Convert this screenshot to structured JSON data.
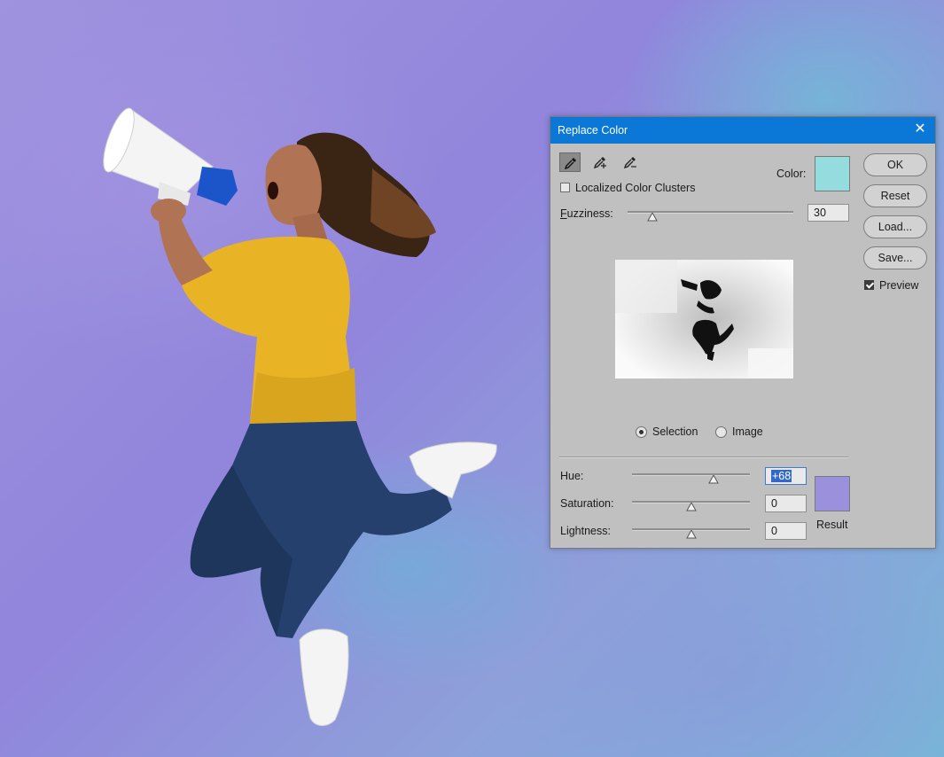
{
  "dialog": {
    "title": "Replace Color",
    "tools": [
      "eyedropper-icon",
      "eyedropper-plus-icon",
      "eyedropper-minus-icon"
    ],
    "localized_label": "Localized Color Clusters",
    "localized_checked": false,
    "color_label": "Color:",
    "color_hex": "#95dcde",
    "fuzziness_label": "Fuzziness:",
    "fuzziness_value": "30",
    "fuzziness_max": 200,
    "view_selection_label": "Selection",
    "view_image_label": "Image",
    "view_selected": "Selection",
    "hue_label": "Hue:",
    "hue_value": "+68",
    "saturation_label": "Saturation:",
    "saturation_value": "0",
    "lightness_label": "Lightness:",
    "lightness_value": "0",
    "result_label": "Result",
    "result_hex": "#9a90dc",
    "buttons": {
      "ok": "OK",
      "reset": "Reset",
      "load": "Load...",
      "save": "Save..."
    },
    "preview_label": "Preview",
    "preview_checked": true,
    "title_bar_color": "#0b78d7"
  },
  "canvas": {
    "background_colors": [
      "#9f93df",
      "#7ab3d8"
    ],
    "subject": "woman-jumping-with-megaphone"
  }
}
